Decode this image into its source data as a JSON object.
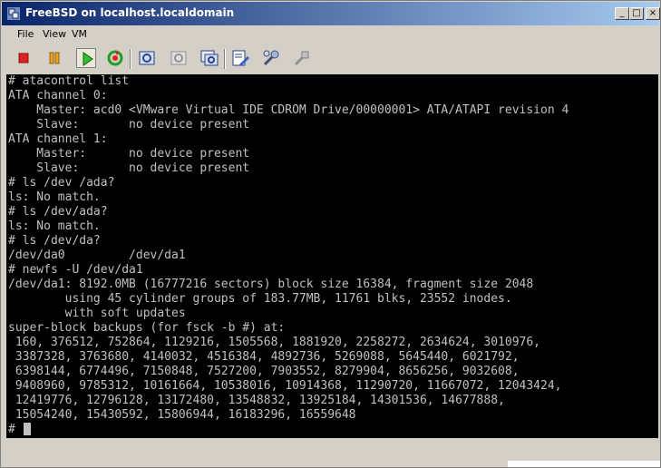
{
  "window": {
    "title": "FreeBSD on localhost.localdomain",
    "controls": {
      "minimize": "_",
      "maximize": "□",
      "close": "×"
    }
  },
  "menu": {
    "file": "File",
    "view": "View",
    "vm": "VM"
  },
  "toolbar": {
    "icons": [
      "stop-icon",
      "pause-icon",
      "play-icon",
      "reset-icon",
      "snapshot-icon",
      "revert-snapshot-icon",
      "snapshot-manager-icon",
      "edit-settings-icon",
      "tools-icon",
      "connect-icon"
    ]
  },
  "console": {
    "lines": [
      "# atacontrol list",
      "ATA channel 0:",
      "    Master: acd0 <VMware Virtual IDE CDROM Drive/00000001> ATA/ATAPI revision 4",
      "    Slave:       no device present",
      "ATA channel 1:",
      "    Master:      no device present",
      "    Slave:       no device present",
      "# ls /dev /ada?",
      "ls: No match.",
      "# ls /dev/ada?",
      "ls: No match.",
      "# ls /dev/da?",
      "/dev/da0         /dev/da1",
      "# newfs -U /dev/da1",
      "/dev/da1: 8192.0MB (16777216 sectors) block size 16384, fragment size 2048",
      "        using 45 cylinder groups of 183.77MB, 11761 blks, 23552 inodes.",
      "        with soft updates",
      "super-block backups (for fsck -b #) at:",
      " 160, 376512, 752864, 1129216, 1505568, 1881920, 2258272, 2634624, 3010976,",
      " 3387328, 3763680, 4140032, 4516384, 4892736, 5269088, 5645440, 6021792,",
      " 6398144, 6774496, 7150848, 7527200, 7903552, 8279904, 8656256, 9032608,",
      " 9408960, 9785312, 10161664, 10538016, 10914368, 11290720, 11667072, 12043424,",
      " 12419776, 12796128, 13172480, 13548832, 13925184, 14301536, 14677888,",
      " 15054240, 15430592, 15806944, 16183296, 16559648",
      "# "
    ]
  },
  "colors": {
    "titlebar_start": "#0a246a",
    "titlebar_end": "#a6caf0",
    "console_bg": "#000000",
    "console_fg": "#c0c0c0",
    "chrome": "#d4d0c8"
  }
}
